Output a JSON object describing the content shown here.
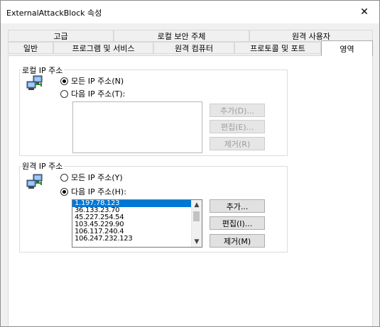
{
  "window": {
    "title": "ExternalAttackBlock 속성",
    "close_glyph": "✕"
  },
  "tabs_row1": [
    "고급",
    "로컬 보안 주체",
    "원격 사용자"
  ],
  "tabs_row2": [
    "일반",
    "프로그램 및 서비스",
    "원격 컴퓨터",
    "프로토콜 및 포트",
    "영역"
  ],
  "active_tab": "영역",
  "local_ip": {
    "legend": "로컬 IP 주소",
    "icon": "network-computers-icon",
    "radio_any": "모든 IP 주소(N)",
    "radio_these": "다음 IP 주소(T):",
    "selected": "any",
    "addresses": [],
    "buttons": {
      "add": "추가(D)...",
      "edit": "편집(E)...",
      "remove": "제거(R)"
    }
  },
  "remote_ip": {
    "legend": "원격 IP 주소",
    "icon": "network-computers-icon",
    "radio_any": "모든 IP 주소(Y)",
    "radio_these": "다음 IP 주소(H):",
    "selected": "these",
    "addresses": [
      "1.197.78.123",
      "36.133.23.70",
      "45.227.254.54",
      "103.45.229.90",
      "106.117.240.4",
      "106.247.232.123"
    ],
    "selected_address": "1.197.78.123",
    "buttons": {
      "add": "추가...",
      "edit": "편집(I)...",
      "remove": "제거(M)"
    }
  },
  "colors": {
    "selection": "#0078d7",
    "window_bg": "#f0f0f0",
    "panel_bg": "#ffffff"
  }
}
